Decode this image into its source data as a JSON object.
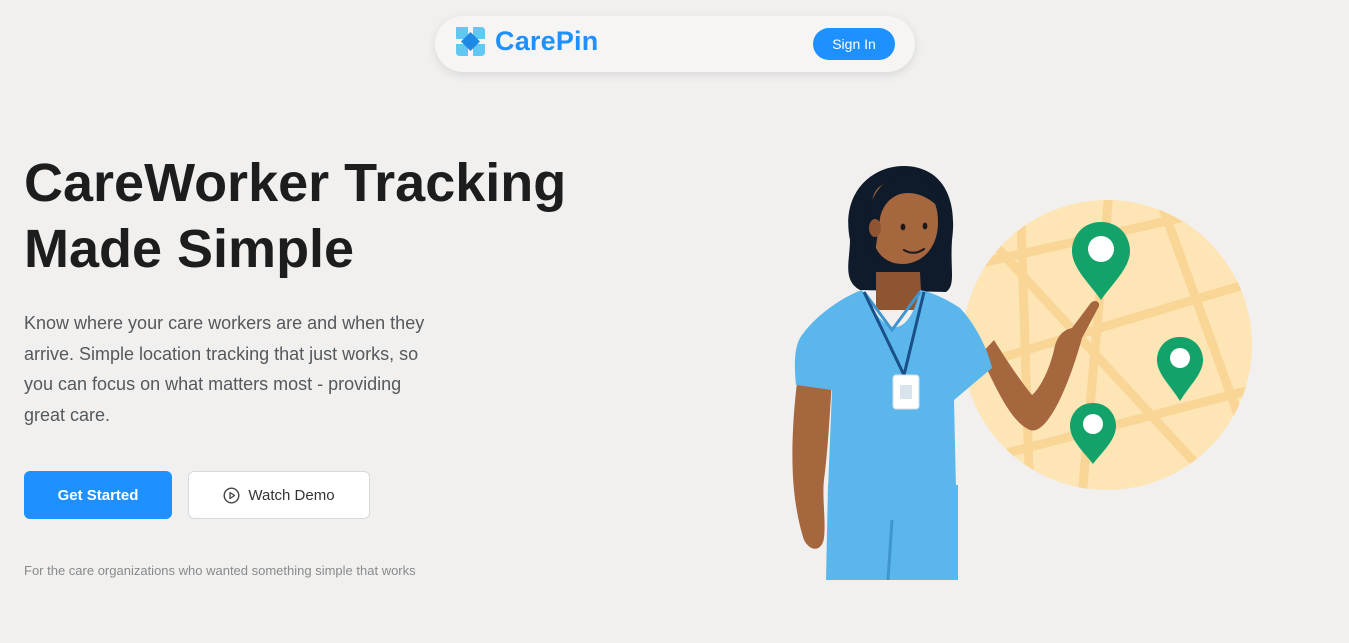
{
  "nav": {
    "brand": "CarePin",
    "signin_label": "Sign In"
  },
  "hero": {
    "title_line1": "CareWorker Tracking",
    "title_line2": "Made Simple",
    "description": "Know where your care workers are and when they arrive. Simple location tracking that just works, so you can focus on what matters most - providing great care.",
    "primary_cta": "Get Started",
    "secondary_cta": "Watch Demo",
    "footnote": "For the care organizations who wanted something simple that works"
  },
  "icons": {
    "logo": "carepin-logo-icon",
    "play": "play-circle-icon",
    "map_pins": "map-pin-icon"
  },
  "colors": {
    "accent": "#1e90ff",
    "background": "#f1f0ef",
    "pin_green": "#12a26a",
    "map_circle": "#fde5b6",
    "scrubs": "#5bb6ec"
  }
}
